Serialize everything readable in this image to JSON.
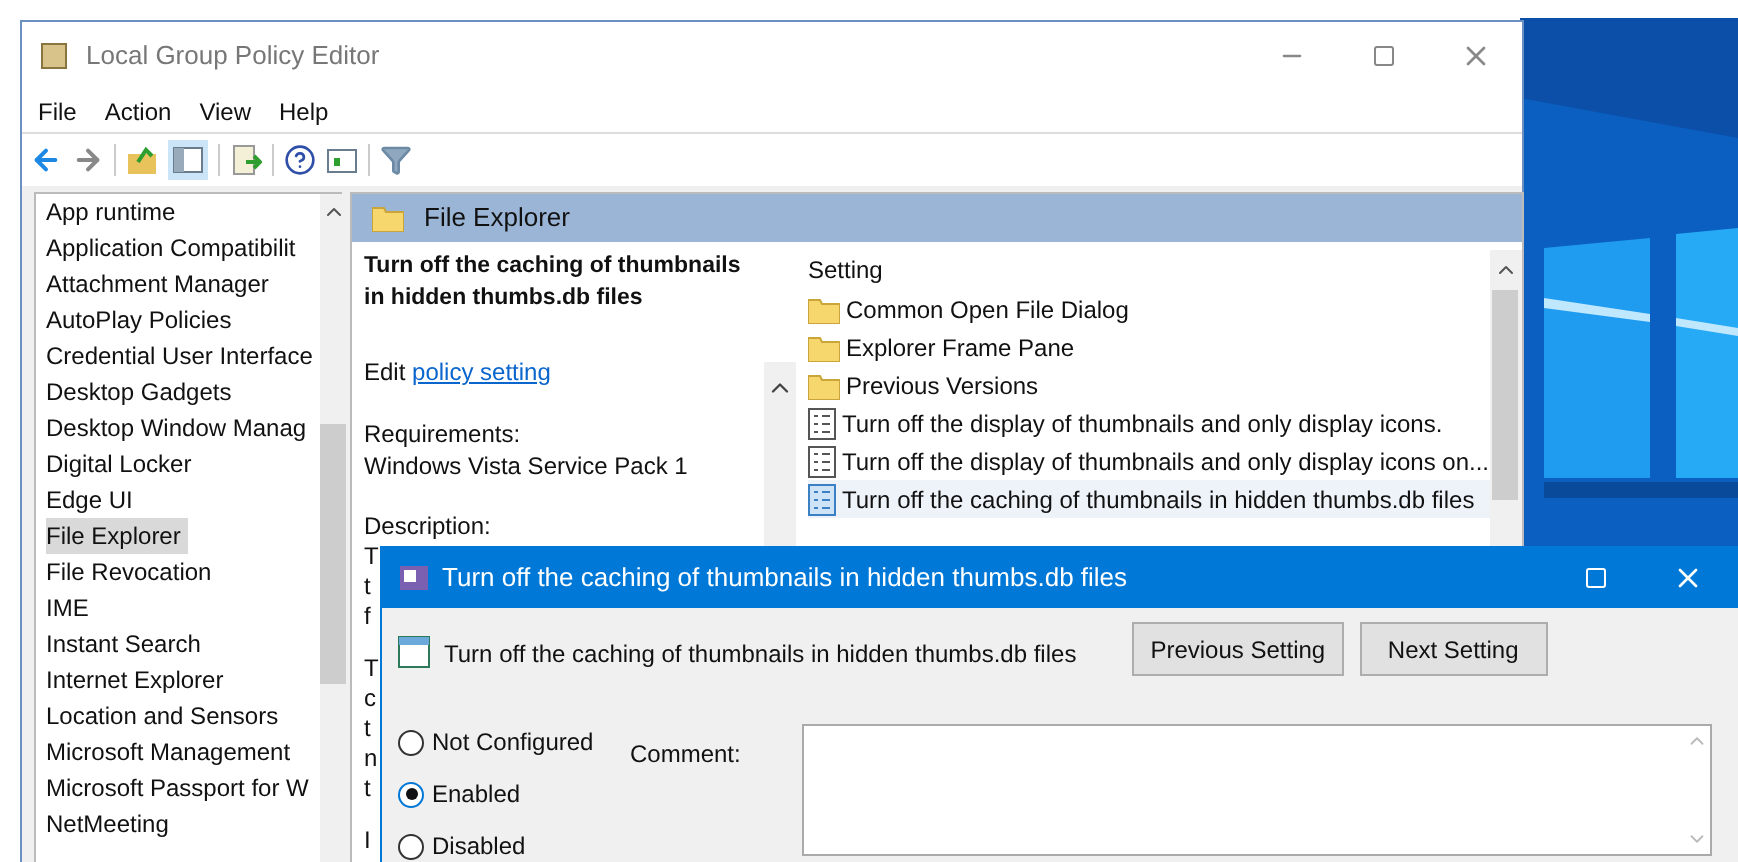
{
  "window": {
    "title": "Local Group Policy Editor"
  },
  "menu": [
    "File",
    "Action",
    "View",
    "Help"
  ],
  "tree": {
    "items": [
      {
        "label": "App runtime",
        "selected": false
      },
      {
        "label": "Application Compatibilit",
        "selected": false
      },
      {
        "label": "Attachment Manager",
        "selected": false
      },
      {
        "label": "AutoPlay Policies",
        "selected": false
      },
      {
        "label": "Credential User Interface",
        "selected": false
      },
      {
        "label": "Desktop Gadgets",
        "selected": false
      },
      {
        "label": "Desktop Window Manag",
        "selected": false
      },
      {
        "label": "Digital Locker",
        "selected": false
      },
      {
        "label": "Edge UI",
        "selected": false
      },
      {
        "label": "File Explorer",
        "selected": true
      },
      {
        "label": "File Revocation",
        "selected": false
      },
      {
        "label": "IME",
        "selected": false
      },
      {
        "label": "Instant Search",
        "selected": false
      },
      {
        "label": "Internet Explorer",
        "selected": false
      },
      {
        "label": "Location and Sensors",
        "selected": false
      },
      {
        "label": "Microsoft Management",
        "selected": false
      },
      {
        "label": "Microsoft Passport for W",
        "selected": false
      },
      {
        "label": "NetMeeting",
        "selected": false
      }
    ]
  },
  "details": {
    "header": "File Explorer",
    "policy_title": "Turn off the caching of thumbnails in hidden thumbs.db files",
    "edit_prefix": "Edit",
    "edit_link": "policy setting",
    "requirements_label": "Requirements:",
    "requirements": "Windows Vista Service Pack 1",
    "description_label": "Description:",
    "description_fragments": [
      [
        "T",
        "t",
        "f"
      ],
      [
        "T",
        "c",
        "t",
        "n",
        "t"
      ],
      [
        "I"
      ]
    ]
  },
  "settings": {
    "column": "Setting",
    "rows": [
      {
        "label": "Common Open File Dialog",
        "kind": "folder",
        "selected": false
      },
      {
        "label": "Explorer Frame Pane",
        "kind": "folder",
        "selected": false
      },
      {
        "label": "Previous Versions",
        "kind": "folder",
        "selected": false
      },
      {
        "label": "Turn off the display of thumbnails and only display icons.",
        "kind": "policy",
        "selected": false
      },
      {
        "label": "Turn off the display of thumbnails and only display icons on...",
        "kind": "policy",
        "selected": false
      },
      {
        "label": "Turn off the caching of thumbnails in hidden thumbs.db files",
        "kind": "policy",
        "selected": true
      }
    ]
  },
  "dialog": {
    "title": "Turn off the caching of thumbnails in hidden thumbs.db files",
    "policy_name": "Turn off the caching of thumbnails in hidden thumbs.db files",
    "buttons": [
      {
        "label": "Previous Setting"
      },
      {
        "label": "Next Setting"
      }
    ],
    "options": [
      {
        "label": "Not Configured",
        "selected": false
      },
      {
        "label": "Enabled",
        "selected": true
      },
      {
        "label": "Disabled",
        "selected": false
      }
    ],
    "comment_label": "Comment:"
  }
}
